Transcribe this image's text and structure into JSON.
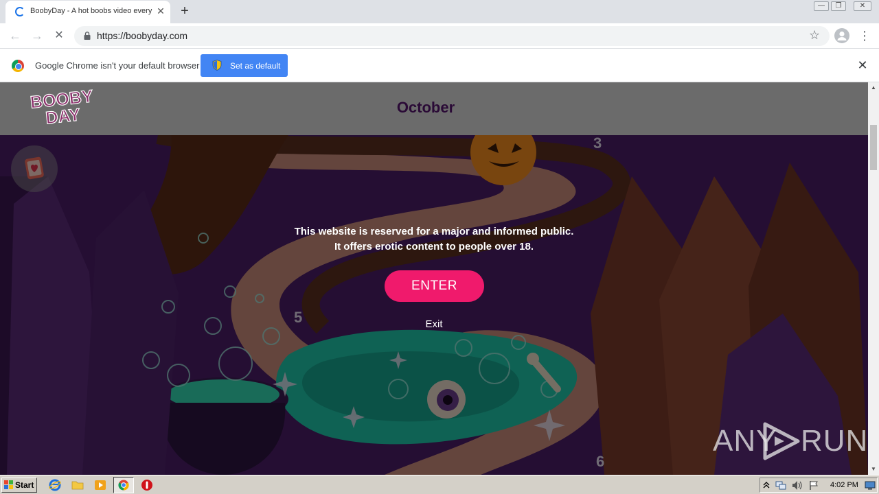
{
  "browser": {
    "tab": {
      "title": "BoobyDay - A hot boobs video every",
      "close_glyph": "✕"
    },
    "new_tab_glyph": "+",
    "window_controls": {
      "minimize": "—",
      "restore": "❐",
      "close": "✕"
    },
    "toolbar": {
      "back_glyph": "←",
      "forward_glyph": "→",
      "reload_glyph": "✕",
      "url": "https://boobyday.com",
      "star_glyph": "☆",
      "menu_glyph": "⋮"
    },
    "infobar": {
      "message": "Google Chrome isn't your default browser",
      "button_label": "Set as default",
      "close_glyph": "✕"
    }
  },
  "site": {
    "logo_top": "BOOBY",
    "logo_bottom": "DAY",
    "month": "October",
    "age_gate": {
      "line1": "This website is reserved for a major and informed public.",
      "line2": "It offers erotic content to people over 18.",
      "enter_label": "ENTER",
      "exit_label": "Exit"
    },
    "map_numbers": [
      "3",
      "5",
      "6"
    ]
  },
  "watermark": {
    "left": "ANY",
    "right": "RUN"
  },
  "scrollbar": {
    "up_glyph": "▲",
    "down_glyph": "▼"
  },
  "taskbar": {
    "start_label": "Start",
    "clock": "4:02 PM"
  },
  "colors": {
    "enter_button": "#f01a6c",
    "set_default_button": "#4285f4",
    "scene_purple": "#5a2a78",
    "scene_teal": "#1fc4a8"
  }
}
